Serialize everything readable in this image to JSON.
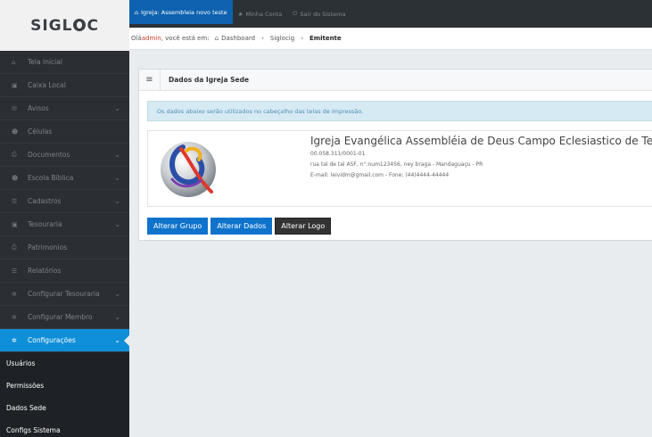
{
  "app": {
    "logo": "SIGLOC",
    "logo_before": "SIGL",
    "logo_after": "C"
  },
  "colors": {
    "primary": "#0f73cc",
    "sidebar_active": "#0f8fd8",
    "topbar_active": "#0e62b0",
    "sidebar_bg": "#2b2f33"
  },
  "topbar": {
    "tabs": [
      {
        "icon": "home-icon",
        "label": "Igreja: Assembleia novo teste"
      },
      {
        "icon": "star-icon",
        "label": "Minha Conta"
      },
      {
        "icon": "power-icon",
        "label": "Sair do Sistema"
      }
    ]
  },
  "breadcrumb": {
    "prefix": "Olá ",
    "user": "admin",
    "suffix": ", você está em:",
    "items": [
      "Dashboard",
      "Siglocig",
      "Emitente"
    ]
  },
  "sidebar": {
    "items": [
      {
        "icon": "home-icon",
        "label": "Tela Inicial",
        "has_children": false
      },
      {
        "icon": "cash-icon",
        "label": "Caixa Local",
        "has_children": false
      },
      {
        "icon": "mail-icon",
        "label": "Avisos",
        "has_children": true
      },
      {
        "icon": "users-icon",
        "label": "Células",
        "has_children": false
      },
      {
        "icon": "print-icon",
        "label": "Documentos",
        "has_children": true
      },
      {
        "icon": "users-icon",
        "label": "Escola Bíblica",
        "has_children": true
      },
      {
        "icon": "list-icon",
        "label": "Cadastros",
        "has_children": true
      },
      {
        "icon": "cash-icon",
        "label": "Tesouraria",
        "has_children": true
      },
      {
        "icon": "print-icon",
        "label": "Patrimonios",
        "has_children": false
      },
      {
        "icon": "list-icon",
        "label": "Relatórios",
        "has_children": false
      },
      {
        "icon": "gear-icon",
        "label": "Configurar Tesouraria",
        "has_children": true
      },
      {
        "icon": "gear-icon",
        "label": "Configurar Membro",
        "has_children": true
      },
      {
        "icon": "gear-icon",
        "label": "Configurações",
        "has_children": true,
        "active": true
      }
    ],
    "submenu": [
      "Usuários",
      "Permissões",
      "Dados Sede",
      "Configs Sistema"
    ]
  },
  "panel": {
    "title": "Dados da Igreja Sede",
    "alert": "Os dados abaixo serão utilizados no cabeçalho das telas de impressão.",
    "church": {
      "name": "Igreja Evangélica Assembléia de Deus Campo Eclesiastico de Teste",
      "cnpj": "00.058.311/0001-01",
      "address": "rua tal de tal ASF, n°:num123456, ney braga - Mandaguaçu - PR",
      "contact": "E-mail: leividm@gmail.com - Fone: (44)4444-44444"
    },
    "buttons": {
      "group": "Alterar Grupo",
      "data": "Alterar Dados",
      "logo": "Alterar Logo"
    }
  }
}
